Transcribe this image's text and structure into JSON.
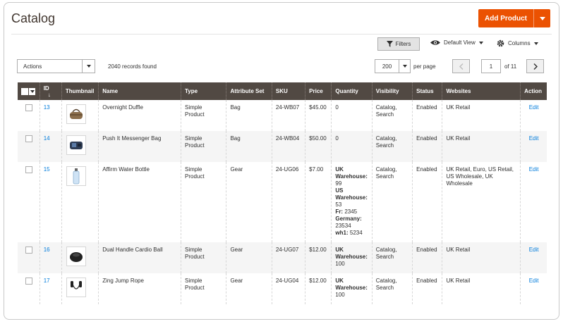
{
  "page": {
    "title": "Catalog"
  },
  "toolbar": {
    "add_product": "Add Product",
    "filters": "Filters",
    "default_view": "Default View",
    "columns": "Columns",
    "actions": "Actions",
    "records_found": "2040 records found",
    "per_page_value": "200",
    "per_page_label": "per page",
    "current_page": "1",
    "of_pages": "of 11"
  },
  "colors": {
    "accent": "#eb5202",
    "header_bg": "#514943",
    "link": "#007bdb"
  },
  "grid": {
    "headers": {
      "id": "ID",
      "thumbnail": "Thumbnail",
      "name": "Name",
      "type": "Type",
      "attribute_set": "Attribute Set",
      "sku": "SKU",
      "price": "Price",
      "quantity": "Quantity",
      "visibility": "Visibility",
      "status": "Status",
      "websites": "Websites",
      "action": "Action"
    },
    "rows": [
      {
        "id": "13",
        "thumb_icon": "duffle-bag-icon",
        "name": "Overnight Duffle",
        "type": "Simple Product",
        "attribute_set": "Bag",
        "sku": "24-WB07",
        "price": "$45.00",
        "quantity": [
          {
            "label": "",
            "value": "0"
          }
        ],
        "visibility": "Catalog, Search",
        "status": "Enabled",
        "websites": "UK Retail",
        "action": "Edit"
      },
      {
        "id": "14",
        "thumb_icon": "messenger-bag-icon",
        "name": "Push It Messenger Bag",
        "type": "Simple Product",
        "attribute_set": "Bag",
        "sku": "24-WB04",
        "price": "$50.00",
        "quantity": [
          {
            "label": "",
            "value": "0"
          }
        ],
        "visibility": "Catalog, Search",
        "status": "Enabled",
        "websites": "UK Retail",
        "action": "Edit"
      },
      {
        "id": "15",
        "thumb_icon": "water-bottle-icon",
        "name": "Affirm Water Bottle",
        "type": "Simple Product",
        "attribute_set": "Gear",
        "sku": "24-UG06",
        "price": "$7.00",
        "quantity": [
          {
            "label": "UK Warehouse:",
            "value": "99"
          },
          {
            "label": "US Warehouse:",
            "value": "53"
          },
          {
            "label": "Fr:",
            "value": "2345"
          },
          {
            "label": "Germany:",
            "value": "23534"
          },
          {
            "label": "wh1:",
            "value": "5234"
          }
        ],
        "visibility": "Catalog, Search",
        "status": "Enabled",
        "websites": "UK Retail, Euro, US Retail, US Wholesale, UK Wholesale",
        "action": "Edit"
      },
      {
        "id": "16",
        "thumb_icon": "cardio-ball-icon",
        "name": "Dual Handle Cardio Ball",
        "type": "Simple Product",
        "attribute_set": "Gear",
        "sku": "24-UG07",
        "price": "$12.00",
        "quantity": [
          {
            "label": "UK Warehouse:",
            "value": "100"
          }
        ],
        "visibility": "Catalog, Search",
        "status": "Enabled",
        "websites": "UK Retail",
        "action": "Edit"
      },
      {
        "id": "17",
        "thumb_icon": "jump-rope-icon",
        "name": "Zing Jump Rope",
        "type": "Simple Product",
        "attribute_set": "Gear",
        "sku": "24-UG04",
        "price": "$12.00",
        "quantity": [
          {
            "label": "UK Warehouse:",
            "value": "100"
          }
        ],
        "visibility": "Catalog, Search",
        "status": "Enabled",
        "websites": "UK Retail",
        "action": "Edit"
      }
    ]
  }
}
